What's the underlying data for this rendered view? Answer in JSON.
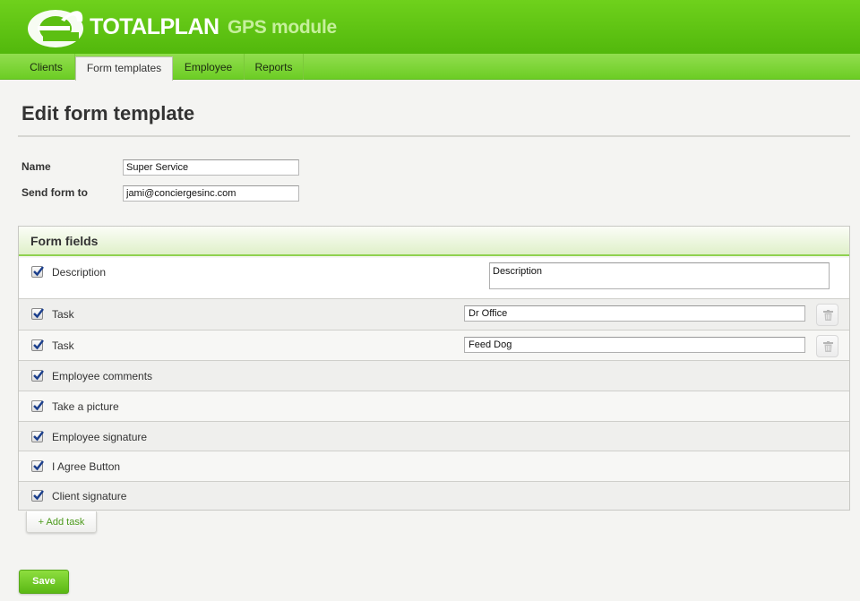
{
  "header": {
    "brand": "TOTALPLAN",
    "module": "GPS module",
    "logo_icon": "e-logo-icon",
    "colors": {
      "header_green": "#5cc313",
      "accent_green": "#8fd14f",
      "link_green": "#4c9a1c"
    }
  },
  "tabs": [
    {
      "label": "Clients",
      "active": false
    },
    {
      "label": "Form templates",
      "active": true
    },
    {
      "label": "Employee",
      "active": false
    },
    {
      "label": "Reports",
      "active": false
    }
  ],
  "page": {
    "title": "Edit form template"
  },
  "form": {
    "name_label": "Name",
    "name_value": "Super Service",
    "send_label": "Send form to",
    "send_value": "jami@conciergesinc.com"
  },
  "panel": {
    "title": "Form fields",
    "rows": [
      {
        "label": "Description",
        "checked": true,
        "input_value": "Description",
        "kind": "textarea"
      },
      {
        "label": "Task",
        "checked": true,
        "input_value": "Dr Office",
        "kind": "task",
        "delete_icon": "trash-icon"
      },
      {
        "label": "Task",
        "checked": true,
        "input_value": "Feed Dog",
        "kind": "task",
        "delete_icon": "trash-icon"
      },
      {
        "label": "Employee comments",
        "checked": true
      },
      {
        "label": "Take a picture",
        "checked": true
      },
      {
        "label": "Employee signature",
        "checked": true
      },
      {
        "label": "I Agree Button",
        "checked": true
      },
      {
        "label": "Client signature",
        "checked": true
      }
    ]
  },
  "actions": {
    "add_task_label": "+ Add task",
    "save_label": "Save"
  }
}
